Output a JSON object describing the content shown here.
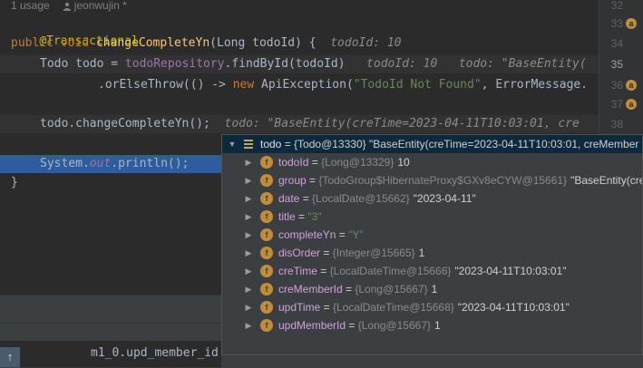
{
  "header": {
    "usages": "1 usage",
    "author": "jeonwujin *"
  },
  "code_lines": {
    "annotation": "@Transactional",
    "l34": {
      "kw1": "public",
      "kw2": "void",
      "method": "changeCompleteYn",
      "params": "(Long todoId) {",
      "hint": "todoId: 10"
    },
    "l35": {
      "start": "Todo todo = ",
      "repo": "todoRepository",
      "call": ".findById(todoId)",
      "hint1": "todoId: 10",
      "hint2": "todo: \"BaseEntity("
    },
    "l36": {
      "call": ".orElseThrow(() -> ",
      "kw": "new",
      "ctor": " ApiException(",
      "str": "\"TodoId Not Found\"",
      "rest": ", ErrorMessage."
    },
    "l38": {
      "code": "todo.changeCompleteYn();",
      "hint": "todo: \"BaseEntity(creTime=2023-04-11T10:03:01, cre"
    },
    "l39": {
      "start": "System.",
      "field": "out",
      "rest": ".println();"
    },
    "l40": "}"
  },
  "gutter": {
    "line_numbers": [
      "32",
      "33",
      "34",
      "35",
      "36",
      "37",
      "38"
    ],
    "icon": "a"
  },
  "debug_popup": {
    "root": {
      "name": "todo",
      "eq": " = ",
      "type": "{Todo@13330}",
      "value": " \"BaseEntity(creTime=2023-04-11T10:03:01, creMember"
    },
    "fields": [
      {
        "name": "todoId",
        "type": "{Long@13329}",
        "value": "10",
        "is_string": false
      },
      {
        "name": "group",
        "type": "{TodoGroup$HibernateProxy$GXv8eCYW@15661}",
        "value": "\"BaseEntity(creT",
        "is_string": false
      },
      {
        "name": "date",
        "type": "{LocalDate@15662}",
        "value": "\"2023-04-11\"",
        "is_string": false
      },
      {
        "name": "title",
        "type": "",
        "value": "\"3\"",
        "is_string": true
      },
      {
        "name": "completeYn",
        "type": "",
        "value": "\"Y\"",
        "is_string": true
      },
      {
        "name": "disOrder",
        "type": "{Integer@15665}",
        "value": "1",
        "is_string": false
      },
      {
        "name": "creTime",
        "type": "{LocalDateTime@15666}",
        "value": "\"2023-04-11T10:03:01\"",
        "is_string": false
      },
      {
        "name": "creMemberId",
        "type": "{Long@15667}",
        "value": "1",
        "is_string": false
      },
      {
        "name": "updTime",
        "type": "{LocalDateTime@15668}",
        "value": "\"2023-04-11T10:03:01\"",
        "is_string": false
      },
      {
        "name": "updMemberId",
        "type": "{Long@15667}",
        "value": "1",
        "is_string": false
      }
    ],
    "field_icon": "f"
  },
  "console": {
    "text": "m1_0.upd_member_id"
  },
  "controls": {
    "scroll_up": "↑"
  },
  "colors": {
    "editor_bg": "#2b2b2b",
    "popup_bg": "#3c3f41",
    "exec_line": "#2d5d9e",
    "field_name": "#cfa2db",
    "string": "#6a8759"
  }
}
